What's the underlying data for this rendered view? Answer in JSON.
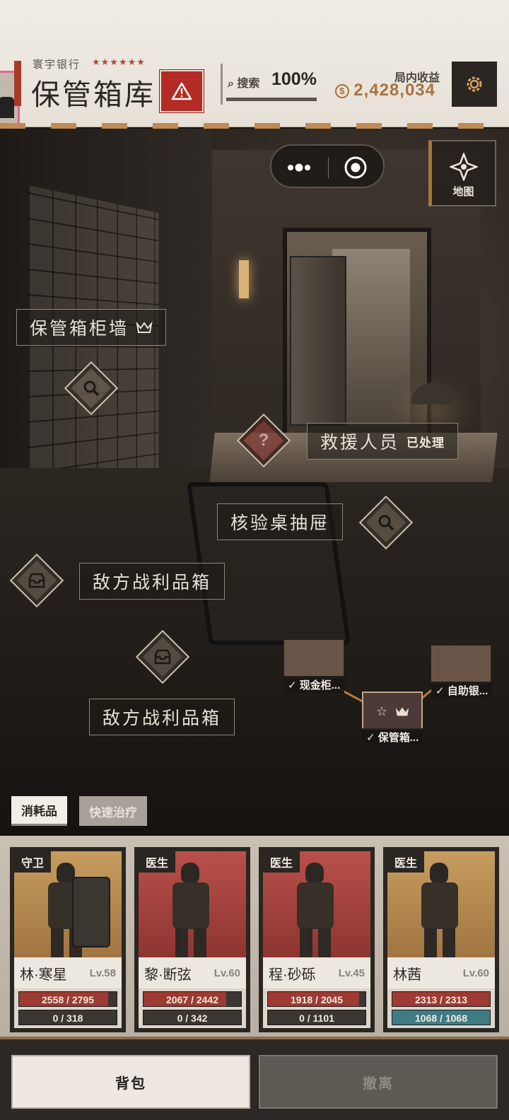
{
  "header": {
    "bank_name": "寰宇银行",
    "stars": "★★★★★★",
    "title": "保管箱库",
    "search": {
      "label": "搜索",
      "percent_text": "100%",
      "progress": 1.0
    },
    "income": {
      "label": "局内收益",
      "value": "2,428,034"
    }
  },
  "scene": {
    "map_label": "地图",
    "pois": {
      "locker_wall": "保管箱柜墙",
      "rescuer": "救援人员",
      "rescuer_status": "已处理",
      "desk_drawer": "核验桌抽屉",
      "enemy_loot_1": "敌方战利品箱",
      "enemy_loot_2": "敌方战利品箱"
    },
    "minimap": {
      "cash_counter": "现金柜...",
      "atm": "自助银...",
      "vault": "保管箱..."
    },
    "tabs": [
      "消耗品",
      "快速治疗"
    ]
  },
  "team": [
    {
      "role": "守卫",
      "name": "林·寒星",
      "level": "Lv.58",
      "hp": "2558 / 2795",
      "hp_ratio": 0.915,
      "energy": "0 / 318",
      "energy_ratio": 0,
      "bg": "gold"
    },
    {
      "role": "医生",
      "name": "黎·断弦",
      "level": "Lv.60",
      "hp": "2067 / 2442",
      "hp_ratio": 0.846,
      "energy": "0 / 342",
      "energy_ratio": 0,
      "bg": "red"
    },
    {
      "role": "医生",
      "name": "程·砂砾",
      "level": "Lv.45",
      "hp": "1918 / 2045",
      "hp_ratio": 0.938,
      "energy": "0 / 1101",
      "energy_ratio": 0,
      "bg": "red"
    },
    {
      "role": "医生",
      "name": "林茜",
      "level": "Lv.60",
      "hp": "2313 / 2313",
      "hp_ratio": 1.0,
      "energy": "1068 / 1068",
      "energy_ratio": 1.0,
      "bg": "gold"
    }
  ],
  "bottom": {
    "bag": "背包",
    "evacuate": "撤离"
  },
  "colors": {
    "accent": "#a8733e",
    "danger": "#b32b24",
    "hp": "#9d3a32",
    "energy": "#3f7b84"
  }
}
